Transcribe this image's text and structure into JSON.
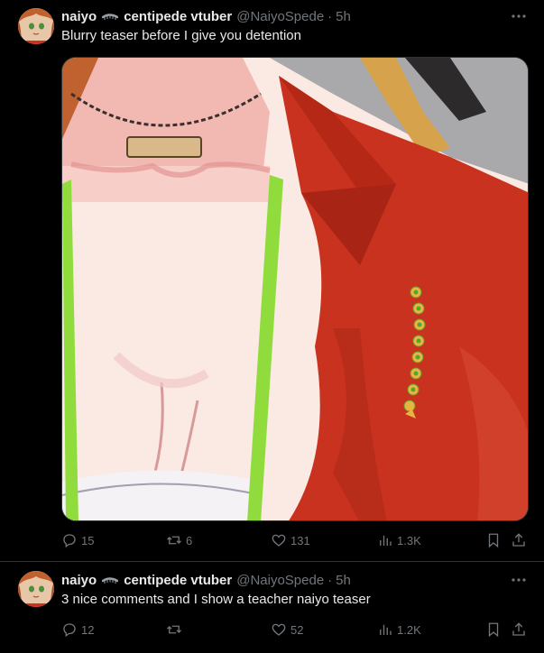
{
  "tweets": [
    {
      "display_name": "naiyo",
      "display_name_suffix": "centipede vtuber",
      "handle": "@NaiyoSpede",
      "separator": "·",
      "time": "5h",
      "text": "Blurry teaser before I give you detention",
      "has_media": true,
      "metrics": {
        "replies": "15",
        "reposts": "6",
        "likes": "131",
        "views": "1.3K"
      }
    },
    {
      "display_name": "naiyo",
      "display_name_suffix": "centipede vtuber",
      "handle": "@NaiyoSpede",
      "separator": "·",
      "time": "5h",
      "text": "3 nice comments and I show a teacher naiyo teaser",
      "has_media": false,
      "metrics": {
        "replies": "12",
        "reposts": "",
        "likes": "52",
        "views": "1.2K"
      }
    }
  ],
  "icons": {
    "more": "more-horizontal-icon",
    "reply": "reply-bubble-icon",
    "repost": "repost-arrows-icon",
    "like": "heart-icon",
    "views": "bar-chart-icon",
    "bookmark": "bookmark-icon",
    "share": "share-upload-icon"
  },
  "colors": {
    "background": "#000000",
    "text_primary": "#e7e9ea",
    "text_secondary": "#71767b",
    "divider": "#2f3336",
    "jacket_red": "#c8321f"
  }
}
